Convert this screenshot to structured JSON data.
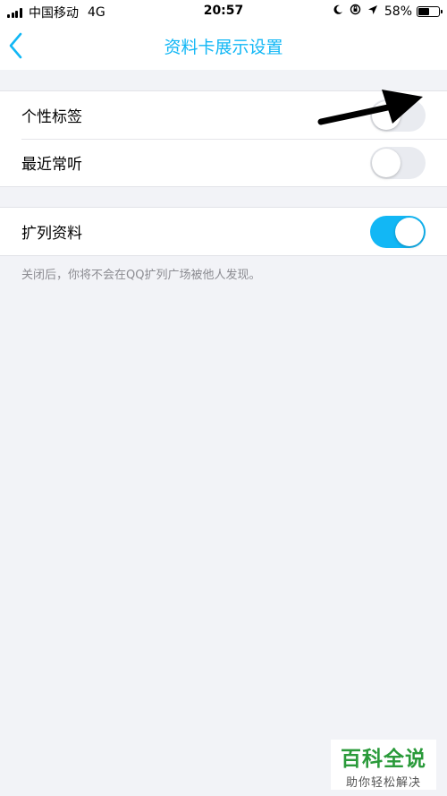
{
  "status_bar": {
    "carrier": "中国移动",
    "network": "4G",
    "time": "20:57",
    "battery_percent": "58%",
    "icons": [
      "moon-icon",
      "orientation-lock-icon",
      "location-icon",
      "battery-icon"
    ]
  },
  "nav": {
    "back_icon": "chevron-left-icon",
    "title": "资料卡展示设置"
  },
  "section1": {
    "items": [
      {
        "label": "个性标签",
        "enabled": false
      },
      {
        "label": "最近常听",
        "enabled": false
      }
    ]
  },
  "section2": {
    "items": [
      {
        "label": "扩列资料",
        "enabled": true
      }
    ],
    "footnote": "关闭后，你将不会在QQ扩列广场被他人发现。"
  },
  "annotation": {
    "type": "arrow",
    "color": "#000000"
  },
  "watermark": {
    "title": "百科全说",
    "subtitle": "助你轻松解决"
  },
  "colors": {
    "accent": "#12b7f5",
    "background": "#f2f3f7",
    "toggle_off": "#e9ebf0",
    "watermark_green": "#2a9a3a"
  }
}
